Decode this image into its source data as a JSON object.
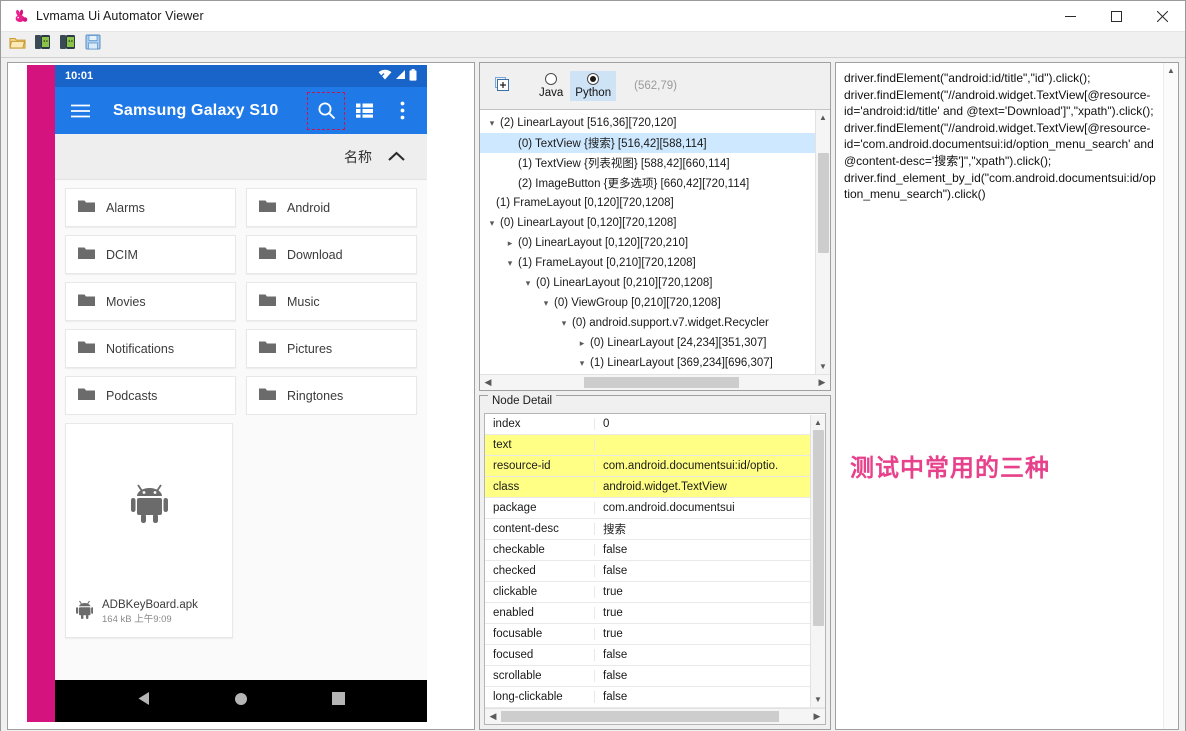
{
  "window": {
    "title": "Lvmama Ui Automator Viewer",
    "app_icon": "rabbit-logo-icon",
    "minimize_label": "—",
    "maximize_label": "□",
    "close_label": "✕"
  },
  "toolbar": {
    "items": [
      {
        "name": "open-folder-button",
        "icon": "open-folder-icon",
        "tooltip": "Open"
      },
      {
        "name": "device-screenshot-button",
        "icon": "device-screenshot-icon",
        "tooltip": "Device Screenshot"
      },
      {
        "name": "device-screenshot-compressed-button",
        "icon": "device-screenshot-compressed-icon",
        "tooltip": "Device Screenshot (compressed)"
      },
      {
        "name": "save-button",
        "icon": "floppy-save-icon",
        "tooltip": "Save"
      }
    ]
  },
  "device": {
    "statusbar": {
      "time": "10:01",
      "wifi": "wifi-icon",
      "signal": "signal-icon",
      "battery": "battery-icon"
    },
    "appbar": {
      "menu_icon": "hamburger-menu-icon",
      "title": "Samsung Galaxy S10",
      "search_icon": "search-icon",
      "listview_icon": "list-view-icon",
      "overflow_icon": "more-options-icon",
      "highlighted": "search-icon"
    },
    "sort_row": {
      "label": "名称",
      "arrow": "chevron-up-icon"
    },
    "folders": [
      "Alarms",
      "Android",
      "DCIM",
      "Download",
      "Movies",
      "Music",
      "Notifications",
      "Pictures",
      "Podcasts",
      "Ringtones"
    ],
    "file_card": {
      "thumb_icon": "android-robot-icon",
      "file_icon": "android-robot-small-icon",
      "name": "ADBKeyBoard.apk",
      "meta": "164 kB 上午9:09"
    },
    "navbar": {
      "back": "back-triangle-icon",
      "home": "home-circle-icon",
      "recents": "recents-square-icon"
    }
  },
  "tree_panel": {
    "expand_all_icon": "expand-all-icon",
    "languages": [
      {
        "label": "Java",
        "selected": false
      },
      {
        "label": "Python",
        "selected": true
      }
    ],
    "coordinates": "(562,79)",
    "nodes": [
      {
        "indent": 0,
        "twisty": "down",
        "text": "(2) LinearLayout [516,36][720,120]",
        "selected": false
      },
      {
        "indent": 1,
        "twisty": "none",
        "text": "(0) TextView {搜索} [516,42][588,114]",
        "selected": true
      },
      {
        "indent": 1,
        "twisty": "none",
        "text": "(1) TextView {列表视图} [588,42][660,114]",
        "selected": false
      },
      {
        "indent": 1,
        "twisty": "none",
        "text": "(2) ImageButton {更多选项} [660,42][720,114]",
        "selected": false
      },
      {
        "indent": -1,
        "twisty": "none",
        "text": "(1) FrameLayout [0,120][720,1208]",
        "selected": false
      },
      {
        "indent": 0,
        "twisty": "down",
        "text": "(0) LinearLayout [0,120][720,1208]",
        "selected": false
      },
      {
        "indent": 1,
        "twisty": "right",
        "text": "(0) LinearLayout [0,120][720,210]",
        "selected": false
      },
      {
        "indent": 1,
        "twisty": "down",
        "text": "(1) FrameLayout [0,210][720,1208]",
        "selected": false
      },
      {
        "indent": 2,
        "twisty": "down",
        "text": "(0) LinearLayout [0,210][720,1208]",
        "selected": false
      },
      {
        "indent": 3,
        "twisty": "down",
        "text": "(0) ViewGroup [0,210][720,1208]",
        "selected": false
      },
      {
        "indent": 4,
        "twisty": "down",
        "text": "(0) android.support.v7.widget.Recycler",
        "selected": false
      },
      {
        "indent": 5,
        "twisty": "right",
        "text": "(0) LinearLayout [24,234][351,307]",
        "selected": false
      },
      {
        "indent": 5,
        "twisty": "down",
        "text": "(1) LinearLayout [369,234][696,307]",
        "selected": false
      }
    ],
    "scroll_up_icon": "chevron-up-icon",
    "scroll_down_icon": "chevron-down-icon",
    "scroll_left_icon": "chevron-left-icon",
    "scroll_right_icon": "chevron-right-icon"
  },
  "node_detail": {
    "title": "Node Detail",
    "rows": [
      {
        "key": "index",
        "value": "0",
        "highlight": false
      },
      {
        "key": "text",
        "value": "",
        "highlight": true
      },
      {
        "key": "resource-id",
        "value": "com.android.documentsui:id/optio.",
        "highlight": true
      },
      {
        "key": "class",
        "value": "android.widget.TextView",
        "highlight": true
      },
      {
        "key": "package",
        "value": "com.android.documentsui",
        "highlight": false
      },
      {
        "key": "content-desc",
        "value": "搜索",
        "highlight": false
      },
      {
        "key": "checkable",
        "value": "false",
        "highlight": false
      },
      {
        "key": "checked",
        "value": "false",
        "highlight": false
      },
      {
        "key": "clickable",
        "value": "true",
        "highlight": false
      },
      {
        "key": "enabled",
        "value": "true",
        "highlight": false
      },
      {
        "key": "focusable",
        "value": "true",
        "highlight": false
      },
      {
        "key": "focused",
        "value": "false",
        "highlight": false
      },
      {
        "key": "scrollable",
        "value": "false",
        "highlight": false
      },
      {
        "key": "long-clickable",
        "value": "false",
        "highlight": false
      }
    ]
  },
  "code_panel": {
    "code": "driver.findElement(\"android:id/title\",\"id\").click();\ndriver.findElement(\"//android.widget.TextView[@resource-id='android:id/title' and @text='Download']\",\"xpath\").click();\ndriver.findElement(\"//android.widget.TextView[@resource-id='com.android.documentsui:id/option_menu_search' and @content-desc='搜索']\",\"xpath\").click();\ndriver.find_element_by_id(\"com.android.documentsui:id/option_menu_search\").click()",
    "annotation": "测试中常用的三种",
    "annotation_color": "#e8418c"
  },
  "colors": {
    "magenta": "#d4137f",
    "appbar_blue": "#1f7ae8",
    "statusbar_blue": "#1964c8",
    "highlight_yellow": "#ffff85",
    "tree_selection": "#cde8ff",
    "radio_selected_bg": "#cfe3f7"
  }
}
